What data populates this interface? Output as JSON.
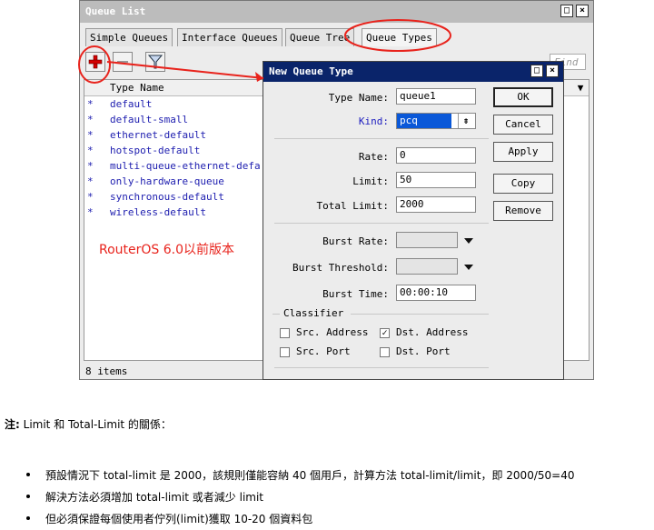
{
  "main_window": {
    "title": "Queue List",
    "title_buttons": [
      "□",
      "×"
    ],
    "tabs": [
      {
        "label": "Simple Queues"
      },
      {
        "label": "Interface Queues"
      },
      {
        "label": "Queue Tree"
      },
      {
        "label": "Queue Types"
      }
    ],
    "find_placeholder": "Find",
    "column_header": "Type Name",
    "rows": [
      {
        "star": "*",
        "name": "default"
      },
      {
        "star": "*",
        "name": "default-small"
      },
      {
        "star": "*",
        "name": "ethernet-default"
      },
      {
        "star": "*",
        "name": "hotspot-default"
      },
      {
        "star": "*",
        "name": "multi-queue-ethernet-defa"
      },
      {
        "star": "*",
        "name": "only-hardware-queue"
      },
      {
        "star": "*",
        "name": "synchronous-default"
      },
      {
        "star": "*",
        "name": "wireless-default"
      }
    ],
    "status": "8 items",
    "note": "RouterOS 6.0以前版本"
  },
  "dialog": {
    "title": "New Queue Type",
    "title_buttons": [
      "□",
      "×"
    ],
    "fields": {
      "type_name": {
        "label": "Type Name:",
        "value": "queue1"
      },
      "kind": {
        "label": "Kind:",
        "value": "pcq"
      },
      "rate": {
        "label": "Rate:",
        "value": "0"
      },
      "limit": {
        "label": "Limit:",
        "value": "50"
      },
      "total_limit": {
        "label": "Total Limit:",
        "value": "2000"
      },
      "burst_rate": {
        "label": "Burst Rate:",
        "value": ""
      },
      "burst_threshold": {
        "label": "Burst Threshold:",
        "value": ""
      },
      "burst_time": {
        "label": "Burst Time:",
        "value": "00:00:10"
      }
    },
    "classifier": {
      "legend": "Classifier",
      "src_address": {
        "label": "Src. Address",
        "checked": false
      },
      "dst_address": {
        "label": "Dst. Address",
        "checked": true
      },
      "src_port": {
        "label": "Src. Port",
        "checked": false
      },
      "dst_port": {
        "label": "Dst. Port",
        "checked": false
      }
    },
    "buttons": {
      "ok": "OK",
      "cancel": "Cancel",
      "apply": "Apply",
      "copy": "Copy",
      "remove": "Remove"
    }
  },
  "notes": {
    "title_bold": "注:",
    "title_rest": " Limit 和 Total-Limit 的關係：",
    "bullets": [
      "預設情況下 total-limit 是 2000，該規則僅能容納 40 個用戶，計算方法 total-limit/limit，即 2000/50=40",
      "解決方法必須增加 total-limit 或者減少 limit",
      "但必須保證每個使用者佇列(limit)獲取 10-20 個資料包"
    ]
  },
  "colors": {
    "annotation_red": "#e8231c",
    "dialog_title": "#0a246a",
    "list_text": "#2020b0"
  }
}
